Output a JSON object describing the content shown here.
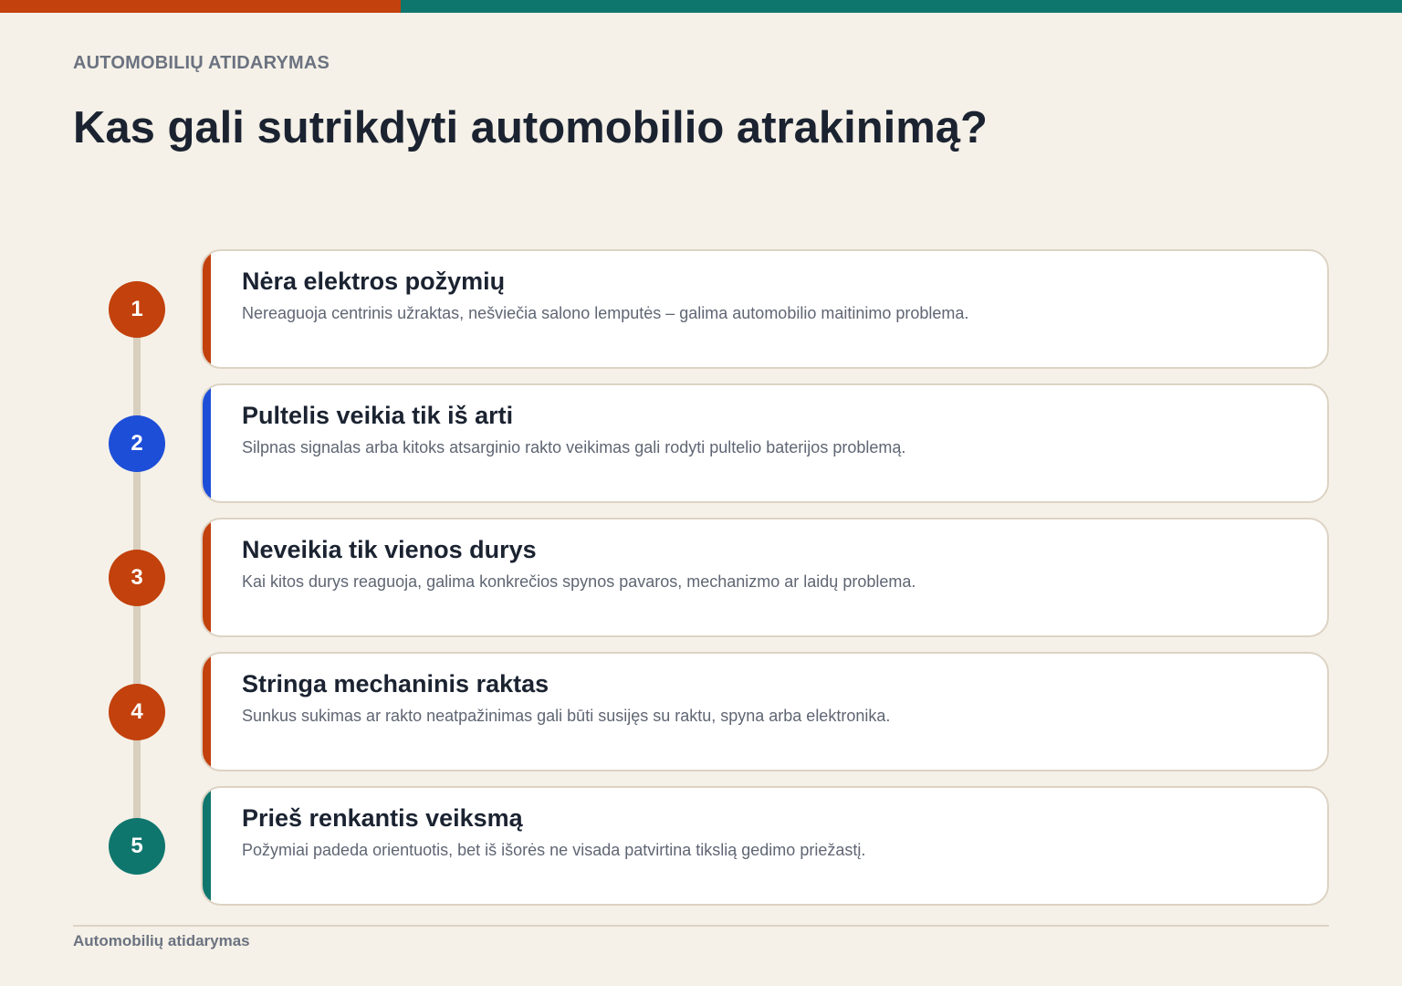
{
  "colors": {
    "background": "#f5f1e8",
    "orange": "#c2410c",
    "blue": "#1d4ed8",
    "teal": "#0f766e",
    "text_dark": "#1b2331",
    "text_muted": "#6b7280"
  },
  "header": {
    "eyebrow": "AUTOMOBILIŲ ATIDARYMAS",
    "title": "Kas gali sutrikdyti automobilio atrakinimą?"
  },
  "steps": [
    {
      "number": "1",
      "title": "Nėra elektros požymių",
      "description": "Nereaguoja centrinis užraktas, nešviečia salono lemputės – galima automobilio maitinimo problema.",
      "color": "#c2410c"
    },
    {
      "number": "2",
      "title": "Pultelis veikia tik iš arti",
      "description": "Silpnas signalas arba kitoks atsarginio rakto veikimas gali rodyti pultelio baterijos problemą.",
      "color": "#1d4ed8"
    },
    {
      "number": "3",
      "title": "Neveikia tik vienos durys",
      "description": "Kai kitos durys reaguoja, galima konkrečios spynos pavaros, mechanizmo ar laidų problema.",
      "color": "#c2410c"
    },
    {
      "number": "4",
      "title": "Stringa mechaninis raktas",
      "description": "Sunkus sukimas ar rakto neatpažinimas gali būti susijęs su raktu, spyna arba elektronika.",
      "color": "#c2410c"
    },
    {
      "number": "5",
      "title": "Prieš renkantis veiksmą",
      "description": "Požymiai padeda orientuotis, bet iš išorės ne visada patvirtina tikslią gedimo priežastį.",
      "color": "#0f766e"
    }
  ],
  "footer": {
    "text": "Automobilių atidarymas"
  }
}
